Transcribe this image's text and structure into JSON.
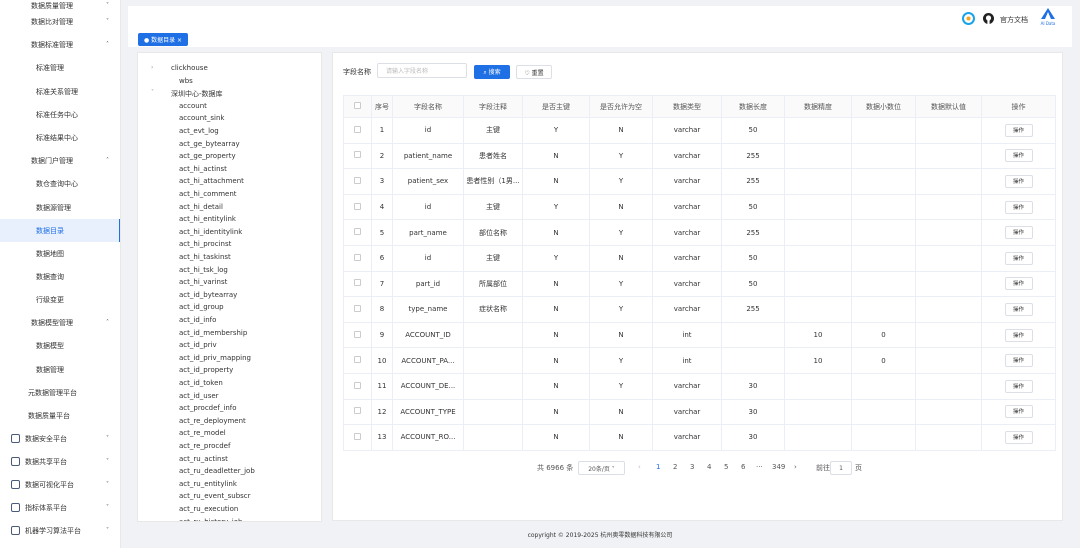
{
  "sidebar": {
    "items": [
      {
        "label": "数据质量管理",
        "chev": "˅"
      },
      {
        "label": "数据比对管理",
        "chev": "˅"
      },
      {
        "label": "数据标准管理",
        "chev": "˄"
      },
      {
        "label": "标准管理"
      },
      {
        "label": "标准关系管理"
      },
      {
        "label": "标准任务中心"
      },
      {
        "label": "标准结果中心"
      },
      {
        "label": "数据门户管理",
        "chev": "˄"
      },
      {
        "label": "数仓查询中心"
      },
      {
        "label": "数据源管理"
      },
      {
        "label": "数据目录"
      },
      {
        "label": "数据地图"
      },
      {
        "label": "数据查询"
      },
      {
        "label": "行级变更"
      },
      {
        "label": "数据模型管理",
        "chev": "˄"
      },
      {
        "label": "数据模型"
      },
      {
        "label": "数据管理"
      },
      {
        "label": "元数据管理平台"
      },
      {
        "label": "数据质量平台"
      },
      {
        "label": "数据安全平台",
        "chev": "˅"
      },
      {
        "label": "数据共享平台",
        "chev": "˅"
      },
      {
        "label": "数据可视化平台",
        "chev": "˅"
      },
      {
        "label": "指标体系平台",
        "chev": "˅"
      },
      {
        "label": "机器学习算法平台",
        "chev": "˅"
      }
    ]
  },
  "header": {
    "docs_label": "官方文档",
    "logo_text": "AI Data"
  },
  "tab": {
    "label": "● 数据目录 ×"
  },
  "tree": {
    "nodes": [
      {
        "label": "clickhouse",
        "arrow": "›"
      },
      {
        "label": "wbs"
      },
      {
        "label": "深圳中心-数据库",
        "arrow": "˅"
      },
      {
        "label": "account"
      },
      {
        "label": "account_sink"
      },
      {
        "label": "act_evt_log"
      },
      {
        "label": "act_ge_bytearray"
      },
      {
        "label": "act_ge_property"
      },
      {
        "label": "act_hi_actinst"
      },
      {
        "label": "act_hi_attachment"
      },
      {
        "label": "act_hi_comment"
      },
      {
        "label": "act_hi_detail"
      },
      {
        "label": "act_hi_entitylink"
      },
      {
        "label": "act_hi_identitylink"
      },
      {
        "label": "act_hi_procinst"
      },
      {
        "label": "act_hi_taskinst"
      },
      {
        "label": "act_hi_tsk_log"
      },
      {
        "label": "act_hi_varinst"
      },
      {
        "label": "act_id_bytearray"
      },
      {
        "label": "act_id_group"
      },
      {
        "label": "act_id_info"
      },
      {
        "label": "act_id_membership"
      },
      {
        "label": "act_id_priv"
      },
      {
        "label": "act_id_priv_mapping"
      },
      {
        "label": "act_id_property"
      },
      {
        "label": "act_id_token"
      },
      {
        "label": "act_id_user"
      },
      {
        "label": "act_procdef_info"
      },
      {
        "label": "act_re_deployment"
      },
      {
        "label": "act_re_model"
      },
      {
        "label": "act_re_procdef"
      },
      {
        "label": "act_ru_actinst"
      },
      {
        "label": "act_ru_deadletter_job"
      },
      {
        "label": "act_ru_entitylink"
      },
      {
        "label": "act_ru_event_subscr"
      },
      {
        "label": "act_ru_execution"
      },
      {
        "label": "act_ru_history_job"
      }
    ]
  },
  "search": {
    "label": "字段名称",
    "placeholder": "请输入字段名称",
    "search_button": "⌕ 搜索",
    "reset_button": "♡ 重置"
  },
  "table": {
    "headers": [
      "",
      "序号",
      "字段名称",
      "字段注释",
      "是否主键",
      "是否允许为空",
      "数据类型",
      "数据长度",
      "数据精度",
      "数据小数位",
      "数据默认值",
      "操作"
    ],
    "op_label": "操作",
    "rows": [
      [
        "1",
        "id",
        "主键",
        "Y",
        "N",
        "varchar",
        "50",
        "",
        "",
        ""
      ],
      [
        "2",
        "patient_name",
        "患者姓名",
        "N",
        "Y",
        "varchar",
        "255",
        "",
        "",
        ""
      ],
      [
        "3",
        "patient_sex",
        "患者性别（1男...",
        "N",
        "Y",
        "varchar",
        "255",
        "",
        "",
        ""
      ],
      [
        "4",
        "id",
        "主键",
        "Y",
        "N",
        "varchar",
        "50",
        "",
        "",
        ""
      ],
      [
        "5",
        "part_name",
        "部位名称",
        "N",
        "Y",
        "varchar",
        "255",
        "",
        "",
        ""
      ],
      [
        "6",
        "id",
        "主键",
        "Y",
        "N",
        "varchar",
        "50",
        "",
        "",
        ""
      ],
      [
        "7",
        "part_id",
        "所属部位",
        "N",
        "Y",
        "varchar",
        "50",
        "",
        "",
        ""
      ],
      [
        "8",
        "type_name",
        "症状名称",
        "N",
        "Y",
        "varchar",
        "255",
        "",
        "",
        ""
      ],
      [
        "9",
        "ACCOUNT_ID",
        "",
        "N",
        "N",
        "int",
        "",
        "10",
        "0",
        ""
      ],
      [
        "10",
        "ACCOUNT_PA...",
        "",
        "N",
        "Y",
        "int",
        "",
        "10",
        "0",
        ""
      ],
      [
        "11",
        "ACCOUNT_DE...",
        "",
        "N",
        "Y",
        "varchar",
        "30",
        "",
        "",
        ""
      ],
      [
        "12",
        "ACCOUNT_TYPE",
        "",
        "N",
        "N",
        "varchar",
        "30",
        "",
        "",
        ""
      ],
      [
        "13",
        "ACCOUNT_RO...",
        "",
        "N",
        "N",
        "varchar",
        "30",
        "",
        "",
        ""
      ]
    ]
  },
  "pager": {
    "total": "共 6966 条",
    "page_size": "20条/页 ˅",
    "prev": "‹",
    "pages": [
      "1",
      "2",
      "3",
      "4",
      "5",
      "6",
      "···",
      "349"
    ],
    "next": "›",
    "goto_label": "前往",
    "goto_value": "1",
    "page_unit": "页"
  },
  "footer": {
    "copyright": "copyright © 2019-2025 杭州奥零数据科技有限公司"
  },
  "colors": {
    "accent": "#1f6fe5",
    "logo_blue": "#1aa3e8",
    "logo_orange": "#f5a623"
  }
}
